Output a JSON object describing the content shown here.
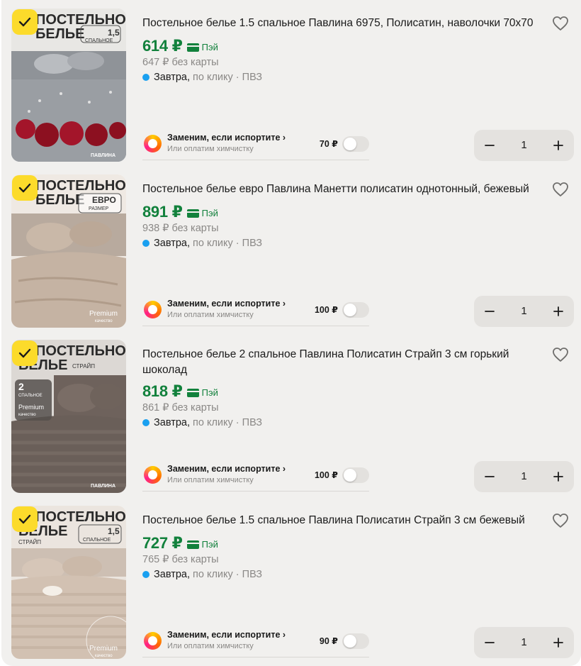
{
  "items": [
    {
      "title": "Постельное белье 1.5 спальное Павлина 6975, Полисатин, наволочки 70х70",
      "price": "614 ₽",
      "pay_label": "Пэй",
      "old_price": "647 ₽ без карты",
      "delivery_day": "Завтра,",
      "delivery_rest": "по клику · ПВЗ",
      "insurance_title": "Заменим, если испортите ›",
      "insurance_sub": "Или оплатим химчистку",
      "insurance_price": "70 ₽",
      "quantity": "1",
      "image": {
        "line1": "ПОСТЕЛЬНОЕ",
        "line2": "БЕЛЬЕ",
        "size_num": "1,5",
        "size_label": "СПАЛЬНОЕ",
        "brand": "ПАВЛИНА",
        "premium": "",
        "premium_sub": ""
      }
    },
    {
      "title": "Постельное белье евро Павлина Манетти полисатин однотонный, бежевый",
      "price": "891 ₽",
      "pay_label": "Пэй",
      "old_price": "938 ₽ без карты",
      "delivery_day": "Завтра,",
      "delivery_rest": "по клику · ПВЗ",
      "insurance_title": "Заменим, если испортите ›",
      "insurance_sub": "Или оплатим химчистку",
      "insurance_price": "100 ₽",
      "quantity": "1",
      "image": {
        "line1": "ПОСТЕЛЬНОЕ",
        "line2": "БЕЛЬЕ",
        "size_num": "ЕВРО",
        "size_label": "РАЗМЕР",
        "brand": "",
        "premium": "Premium",
        "premium_sub": "качество"
      }
    },
    {
      "title": "Постельное белье 2 спальное Павлина Полисатин Страйп 3 см горький шоколад",
      "price": "818 ₽",
      "pay_label": "Пэй",
      "old_price": "861 ₽ без карты",
      "delivery_day": "Завтра,",
      "delivery_rest": "по клику · ПВЗ",
      "insurance_title": "Заменим, если испортите ›",
      "insurance_sub": "Или оплатим химчистку",
      "insurance_price": "100 ₽",
      "quantity": "1",
      "image": {
        "line1": "ПОСТЕЛЬНОЕ",
        "line2": "БЕЛЬЕ",
        "stripe": "СТРАЙП",
        "size_num": "2",
        "size_label": "СПАЛЬНОЕ",
        "brand": "ПАВЛИНА",
        "premium": "Premium",
        "premium_sub": "качество"
      }
    },
    {
      "title": "Постельное белье 1.5 спальное Павлина Полисатин Страйп 3 см бежевый",
      "price": "727 ₽",
      "pay_label": "Пэй",
      "old_price": "765 ₽ без карты",
      "delivery_day": "Завтра,",
      "delivery_rest": "по клику · ПВЗ",
      "insurance_title": "Заменим, если испортите ›",
      "insurance_sub": "Или оплатим химчистку",
      "insurance_price": "90 ₽",
      "quantity": "1",
      "image": {
        "line1": "ПОСТЕЛЬНОЕ",
        "line2": "БЕЛЬЕ",
        "stripe": "СТРАЙП",
        "size_num": "1,5",
        "size_label": "СПАЛЬНОЕ",
        "brand": "",
        "premium": "Premium",
        "premium_sub": "качество"
      }
    }
  ],
  "colors": {
    "price_green": "#12813c",
    "check_yellow": "#fcdb2b",
    "delivery_dot": "#1aa0f0",
    "card_background": "#f1f0ee"
  },
  "icons": [
    "check-icon",
    "heart-icon",
    "minus-icon",
    "plus-icon",
    "insurance-icon",
    "pay-card-icon"
  ]
}
